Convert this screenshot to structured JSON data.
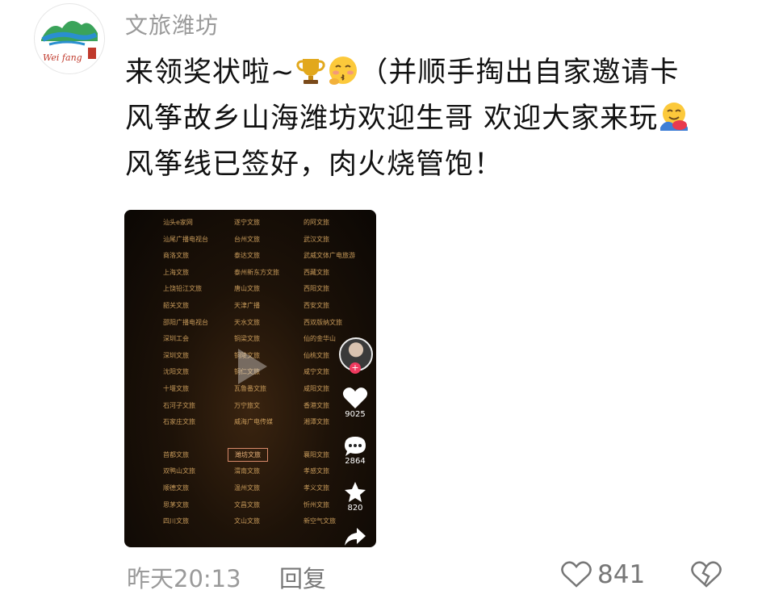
{
  "comment": {
    "username": "文旅潍坊",
    "avatar_text": "Wei fang",
    "lines": [
      {
        "pre": "来领奖状啦~",
        "post": "（并顺手掏出自家邀请卡"
      },
      {
        "pre": "风筝故乡山海潍坊欢迎生哥 欢迎大家来玩",
        "post": ""
      },
      {
        "pre": "风筝线已签好，肉火烧管饱！",
        "post": ""
      }
    ],
    "emojis": [
      "trophy-emoji",
      "blushing-kiss-emoji",
      "hugging-emoji"
    ],
    "timestamp": "昨天20:13",
    "reply_label": "回复",
    "like_count": "841"
  },
  "video": {
    "grid": [
      [
        "汕头e家网",
        "遂宁文旅",
        "的阿文旅"
      ],
      [
        "汕尾广播电视台",
        "台州文旅",
        "武汉文旅"
      ],
      [
        "商洛文旅",
        "泰达文旅",
        "武威文体广电旅游"
      ],
      [
        "上海文旅",
        "泰州新东方文旅",
        "西藏文旅"
      ],
      [
        "上饶铅江文旅",
        "唐山文旅",
        "西阳文旅"
      ],
      [
        "韶关文旅",
        "天津广播",
        "西安文旅"
      ],
      [
        "邵阳广播电视台",
        "天水文旅",
        "西双版纳文旅"
      ],
      [
        "深圳工会",
        "铜梁文旅",
        "仙的金华山"
      ],
      [
        "深圳文旅",
        "铜陵文旅",
        "仙桃文旅"
      ],
      [
        "沈阳文旅",
        "铜仁文旅",
        "咸宁文旅"
      ],
      [
        "十堰文旅",
        "瓦鲁番文旅",
        "咸阳文旅"
      ],
      [
        "石河子文旅",
        "万宁旅文",
        "香港文旅"
      ],
      [
        "石家庄文旅",
        "威海广电传媒",
        "湘潭文旅"
      ],
      [
        "首都文旅",
        "潍坊文旅",
        "襄阳文旅"
      ],
      [
        "双鸭山文旅",
        "渭南文旅",
        "孝感文旅"
      ],
      [
        "顺德文旅",
        "温州文旅",
        "孝义文旅"
      ],
      [
        "思茅文旅",
        "文昌文旅",
        "忻州文旅"
      ],
      [
        "四川文旅",
        "文山文旅",
        "新空气文旅"
      ]
    ],
    "highlight": "潍坊文旅",
    "like_count": "9025",
    "comment_count": "2864",
    "favorite_count": "820"
  },
  "colors": {
    "text": "#111111",
    "meta": "#9a9a9a",
    "highlight_border": "#d88a6a",
    "video_text": "#c79a5a",
    "plus_badge": "#f03a5f"
  }
}
